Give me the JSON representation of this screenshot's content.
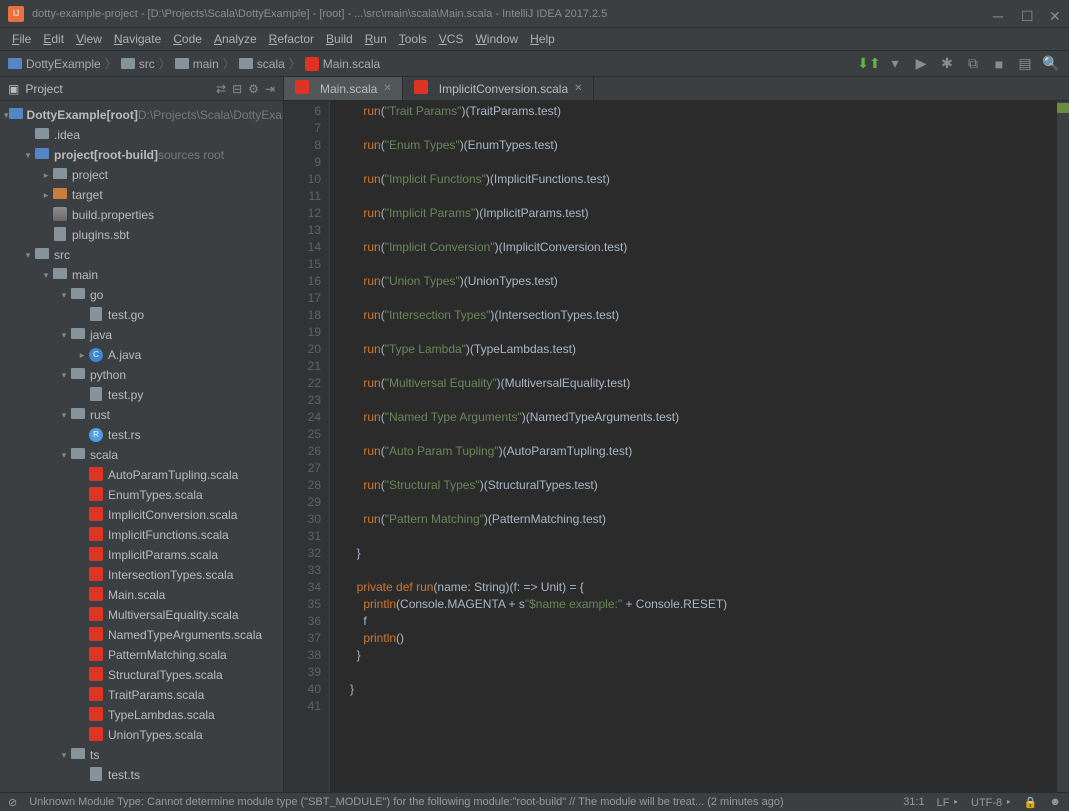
{
  "titlebar": {
    "text": "dotty-example-project - [D:\\Projects\\Scala\\DottyExample] - [root] - ...\\src\\main\\scala\\Main.scala - IntelliJ IDEA 2017.2.5"
  },
  "menu": [
    "File",
    "Edit",
    "View",
    "Navigate",
    "Code",
    "Analyze",
    "Refactor",
    "Build",
    "Run",
    "Tools",
    "VCS",
    "Window",
    "Help"
  ],
  "breadcrumb": [
    {
      "icon": "folder-blue",
      "label": "DottyExample"
    },
    {
      "icon": "folder",
      "label": "src"
    },
    {
      "icon": "folder",
      "label": "main"
    },
    {
      "icon": "folder",
      "label": "scala"
    },
    {
      "icon": "file-scala",
      "label": "Main.scala"
    }
  ],
  "project": {
    "header": "Project",
    "root": {
      "label": "DottyExample",
      "suffix": "[root]",
      "path": "D:\\Projects\\Scala\\DottyExample"
    },
    "tree": [
      {
        "d": 1,
        "ch": "",
        "ic": "folder",
        "label": ".idea"
      },
      {
        "d": 1,
        "ch": "▾",
        "ic": "folder-blue",
        "label": "project",
        "suffix": "[root-build]",
        "hint": "sources root"
      },
      {
        "d": 2,
        "ch": "▸",
        "ic": "folder",
        "label": "project"
      },
      {
        "d": 2,
        "ch": "▸",
        "ic": "folder-orange",
        "label": "target"
      },
      {
        "d": 2,
        "ch": "",
        "ic": "prop",
        "label": "build.properties"
      },
      {
        "d": 2,
        "ch": "",
        "ic": "file",
        "label": "plugins.sbt"
      },
      {
        "d": 1,
        "ch": "▾",
        "ic": "folder",
        "label": "src"
      },
      {
        "d": 2,
        "ch": "▾",
        "ic": "folder",
        "label": "main"
      },
      {
        "d": 3,
        "ch": "▾",
        "ic": "folder",
        "label": "go"
      },
      {
        "d": 4,
        "ch": "",
        "ic": "file",
        "label": "test.go"
      },
      {
        "d": 3,
        "ch": "▾",
        "ic": "folder",
        "label": "java"
      },
      {
        "d": 4,
        "ch": "▸",
        "ic": "java",
        "label": "A.java"
      },
      {
        "d": 3,
        "ch": "▾",
        "ic": "folder",
        "label": "python"
      },
      {
        "d": 4,
        "ch": "",
        "ic": "file",
        "label": "test.py"
      },
      {
        "d": 3,
        "ch": "▾",
        "ic": "folder",
        "label": "rust"
      },
      {
        "d": 4,
        "ch": "",
        "ic": "rust",
        "label": "test.rs"
      },
      {
        "d": 3,
        "ch": "▾",
        "ic": "folder",
        "label": "scala"
      },
      {
        "d": 4,
        "ch": "",
        "ic": "scala",
        "label": "AutoParamTupling.scala"
      },
      {
        "d": 4,
        "ch": "",
        "ic": "scala",
        "label": "EnumTypes.scala"
      },
      {
        "d": 4,
        "ch": "",
        "ic": "scala",
        "label": "ImplicitConversion.scala"
      },
      {
        "d": 4,
        "ch": "",
        "ic": "scala",
        "label": "ImplicitFunctions.scala"
      },
      {
        "d": 4,
        "ch": "",
        "ic": "scala",
        "label": "ImplicitParams.scala"
      },
      {
        "d": 4,
        "ch": "",
        "ic": "scala",
        "label": "IntersectionTypes.scala"
      },
      {
        "d": 4,
        "ch": "",
        "ic": "scala",
        "label": "Main.scala"
      },
      {
        "d": 4,
        "ch": "",
        "ic": "scala",
        "label": "MultiversalEquality.scala"
      },
      {
        "d": 4,
        "ch": "",
        "ic": "scala",
        "label": "NamedTypeArguments.scala"
      },
      {
        "d": 4,
        "ch": "",
        "ic": "scala",
        "label": "PatternMatching.scala"
      },
      {
        "d": 4,
        "ch": "",
        "ic": "scala",
        "label": "StructuralTypes.scala"
      },
      {
        "d": 4,
        "ch": "",
        "ic": "scala",
        "label": "TraitParams.scala"
      },
      {
        "d": 4,
        "ch": "",
        "ic": "scala",
        "label": "TypeLambdas.scala"
      },
      {
        "d": 4,
        "ch": "",
        "ic": "scala",
        "label": "UnionTypes.scala"
      },
      {
        "d": 3,
        "ch": "▾",
        "ic": "folder",
        "label": "ts"
      },
      {
        "d": 4,
        "ch": "",
        "ic": "file",
        "label": "test.ts"
      }
    ]
  },
  "tabs": [
    {
      "label": "Main.scala",
      "icon": "scala",
      "active": true
    },
    {
      "label": "ImplicitConversion.scala",
      "icon": "scala",
      "active": false
    }
  ],
  "editor": {
    "first_line": 6,
    "lines": [
      {
        "n": 6,
        "t": "    run(\"Trait Params\")(TraitParams.test)",
        "clip": true
      },
      {
        "n": 7,
        "t": ""
      },
      {
        "n": 8,
        "t": "    run(\"Enum Types\")(EnumTypes.test)"
      },
      {
        "n": 9,
        "t": ""
      },
      {
        "n": 10,
        "t": "    run(\"Implicit Functions\")(ImplicitFunctions.test)"
      },
      {
        "n": 11,
        "t": ""
      },
      {
        "n": 12,
        "t": "    run(\"Implicit Params\")(ImplicitParams.test)"
      },
      {
        "n": 13,
        "t": ""
      },
      {
        "n": 14,
        "t": "    run(\"Implicit Conversion\")(ImplicitConversion.test)"
      },
      {
        "n": 15,
        "t": ""
      },
      {
        "n": 16,
        "t": "    run(\"Union Types\")(UnionTypes.test)"
      },
      {
        "n": 17,
        "t": ""
      },
      {
        "n": 18,
        "t": "    run(\"Intersection Types\")(IntersectionTypes.test)"
      },
      {
        "n": 19,
        "t": ""
      },
      {
        "n": 20,
        "t": "    run(\"Type Lambda\")(TypeLambdas.test)"
      },
      {
        "n": 21,
        "t": ""
      },
      {
        "n": 22,
        "t": "    run(\"Multiversal Equality\")(MultiversalEquality.test)"
      },
      {
        "n": 23,
        "t": ""
      },
      {
        "n": 24,
        "t": "    run(\"Named Type Arguments\")(NamedTypeArguments.test)"
      },
      {
        "n": 25,
        "t": ""
      },
      {
        "n": 26,
        "t": "    run(\"Auto Param Tupling\")(AutoParamTupling.test)"
      },
      {
        "n": 27,
        "t": ""
      },
      {
        "n": 28,
        "t": "    run(\"Structural Types\")(StructuralTypes.test)"
      },
      {
        "n": 29,
        "t": ""
      },
      {
        "n": 30,
        "t": "    run(\"Pattern Matching\")(PatternMatching.test)"
      },
      {
        "n": 31,
        "t": ""
      },
      {
        "n": 32,
        "t": "  }"
      },
      {
        "n": 33,
        "t": ""
      },
      {
        "n": 34,
        "t": "  private def run(name: String)(f: => Unit) = {"
      },
      {
        "n": 35,
        "t": "    println(Console.MAGENTA + s\"$name example:\" + Console.RESET)"
      },
      {
        "n": 36,
        "t": "    f"
      },
      {
        "n": 37,
        "t": "    println()"
      },
      {
        "n": 38,
        "t": "  }"
      },
      {
        "n": 39,
        "t": ""
      },
      {
        "n": 40,
        "t": "}"
      },
      {
        "n": 41,
        "t": ""
      }
    ]
  },
  "status": {
    "warning": "Unknown Module Type: Cannot determine module type (\"SBT_MODULE\") for the following module:\"root-build\" // The module will be treat... (2 minutes ago)",
    "pos": "31:1",
    "lf": "LF",
    "enc": "UTF-8",
    "lock": "⎘"
  }
}
